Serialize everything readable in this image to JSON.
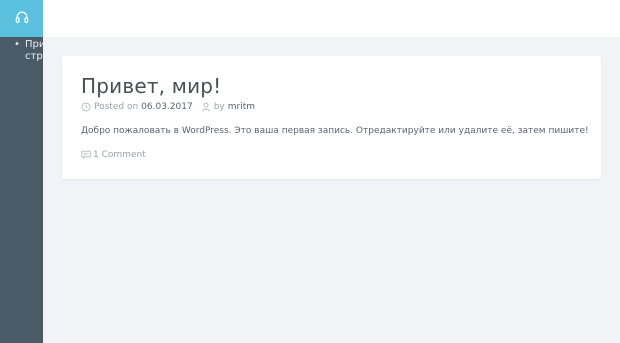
{
  "sidebar": {
    "menu_items": [
      {
        "line1": "Прив",
        "line2": "стра"
      }
    ],
    "header_icon": "headphones-icon",
    "accent_color": "#5bc0de",
    "background_color": "#4b5a67"
  },
  "post": {
    "title": "Привет, мир!",
    "posted_on_label": "Posted on",
    "date": "06.03.2017",
    "by_label": "by",
    "author": "mritm",
    "excerpt": "Добро пожаловать в WordPress. Это ваша первая запись. Отредактируйте или удалите её, затем пишите!",
    "comments": "1 Comment",
    "date_icon": "clock-icon",
    "author_icon": "user-icon",
    "comments_icon": "comment-icon"
  }
}
